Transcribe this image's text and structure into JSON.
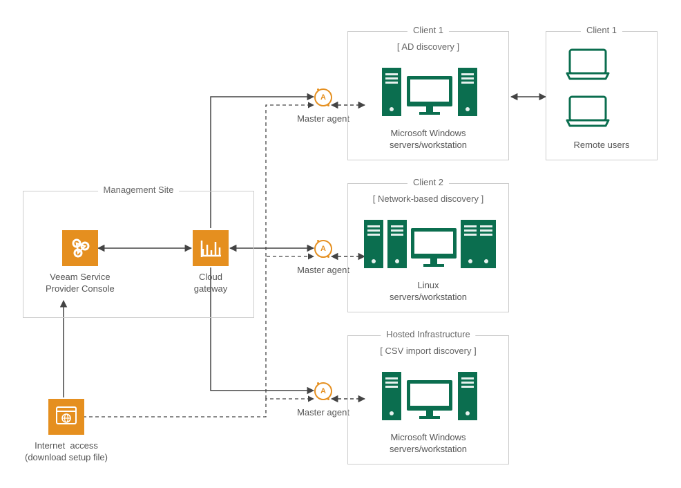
{
  "management": {
    "title": "Management Site",
    "vspc": "Veeam Service\nProvider Console",
    "gateway": "Cloud\ngateway"
  },
  "internet": "Internet  access\n(download setup file)",
  "agents": {
    "a1": "Master agent",
    "a2": "Master agent",
    "a3": "Master agent"
  },
  "client1": {
    "title": "Client 1",
    "discovery": "[ AD discovery ]",
    "caption": "Microsoft Windows\nservers/workstation"
  },
  "client1b": {
    "title": "Client 1",
    "caption": "Remote users"
  },
  "client2": {
    "title": "Client 2",
    "discovery": "[ Network-based discovery ]",
    "caption": "Linux\nservers/workstation"
  },
  "hosted": {
    "title": "Hosted Infrastructure",
    "discovery": "[ CSV import discovery ]",
    "caption": "Microsoft Windows\nservers/workstation"
  }
}
